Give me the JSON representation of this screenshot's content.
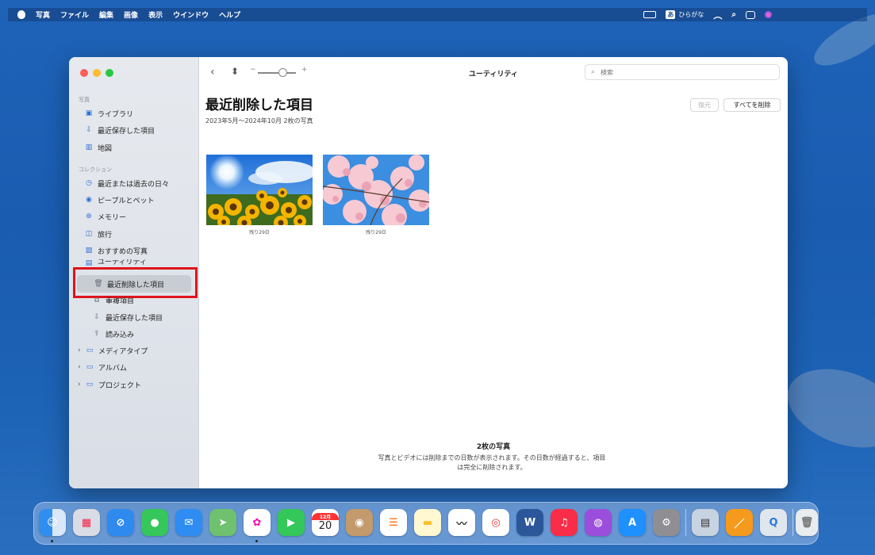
{
  "menubar": {
    "app": "写真",
    "items": [
      "ファイル",
      "編集",
      "画像",
      "表示",
      "ウインドウ",
      "ヘルプ"
    ],
    "ime_badge": "あ",
    "ime_label": "ひらがな"
  },
  "toolbar": {
    "title": "ユーティリティ",
    "slider_minus": "−",
    "slider_plus": "+",
    "search_placeholder": "検索",
    "search_value": ""
  },
  "sidebar": {
    "sec_photos": "写真",
    "library": "ライブラリ",
    "recent_saved": "最近保存した項目",
    "map": "地図",
    "sec_collections": "コレクション",
    "days": "最近または過去の日々",
    "people": "ピープルとペット",
    "memories": "メモリー",
    "trips": "旅行",
    "featured": "おすすめの写真",
    "utility_partial": "ユーティリティ",
    "recently_deleted": "最近削除した項目",
    "duplicates": "重複項目",
    "recent_saved_2": "最近保存した項目",
    "imports": "読み込み",
    "media_types": "メディアタイプ",
    "albums": "アルバム",
    "projects": "プロジェクト"
  },
  "main": {
    "title": "最近削除した項目",
    "subtitle": "2023年5月〜2024年10月   2枚の写真",
    "recover_btn": "復元",
    "delete_all_btn": "すべてを削除",
    "photos": [
      {
        "caption": "残り29日"
      },
      {
        "caption": "残り29日"
      }
    ],
    "footer_title": "2枚の写真",
    "footer_desc": "写真とビデオには削除までの日数が表示されます。その日数が経過すると、項目は完全に削除されます。"
  },
  "dock": {
    "calendar_month": "12月",
    "calendar_day": "20"
  },
  "colors": {
    "highlight": "#e0141b",
    "accent": "#2a6fd6"
  }
}
